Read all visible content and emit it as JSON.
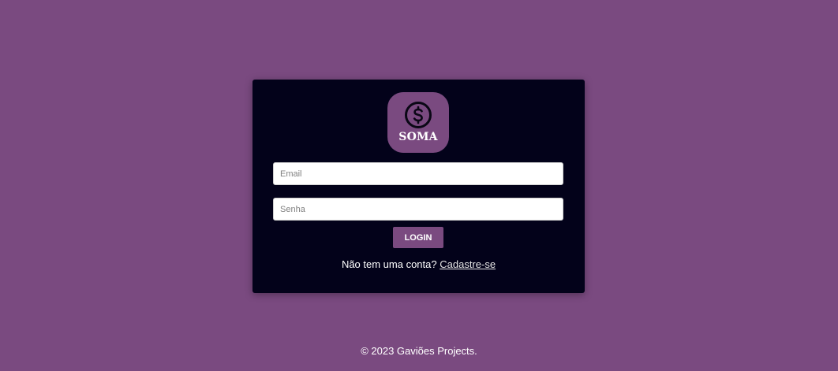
{
  "colors": {
    "background": "#7a4a80",
    "card": "#03021a",
    "accent": "#7a4a80",
    "text": "#ffffff"
  },
  "logo": {
    "icon": "dollar-circle-icon",
    "text": "SOMA"
  },
  "form": {
    "email_placeholder": "Email",
    "email_value": "",
    "password_placeholder": "Senha",
    "password_value": "",
    "login_label": "LOGIN"
  },
  "signup": {
    "prompt": "Não tem uma conta?",
    "link_label": "Cadastre-se"
  },
  "footer": {
    "text": "© 2023 Gaviões Projects."
  }
}
